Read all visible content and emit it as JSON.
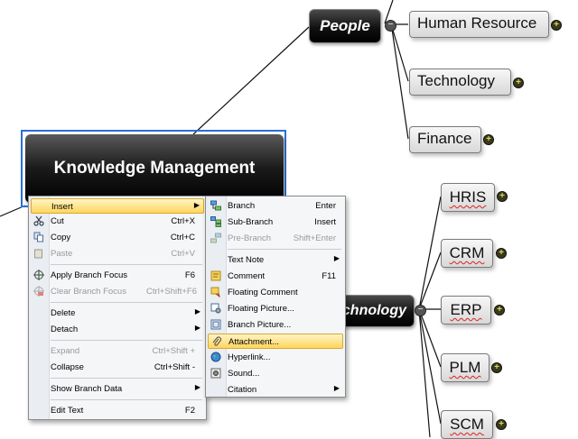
{
  "mindmap": {
    "central": "Knowledge Management",
    "people": "People",
    "technology": "chnology",
    "people_children": [
      "Human Resource",
      "Technology",
      "Finance"
    ],
    "tech_children": [
      "HRIS",
      "CRM",
      "ERP",
      "PLM",
      "SCM"
    ],
    "collapse_symbol": "−",
    "expand_symbol": "+"
  },
  "context_menu": {
    "items": [
      {
        "label": "Insert",
        "shortcut": "",
        "submenu": true,
        "highlighted": true,
        "icon": ""
      },
      {
        "label": "Cut",
        "shortcut": "Ctrl+X",
        "icon": "scissors-icon"
      },
      {
        "label": "Copy",
        "shortcut": "Ctrl+C",
        "icon": "copy-icon"
      },
      {
        "label": "Paste",
        "shortcut": "Ctrl+V",
        "disabled": true,
        "icon": "paste-icon"
      },
      {
        "label": "Apply Branch Focus",
        "shortcut": "F6",
        "icon": "focus-icon"
      },
      {
        "label": "Clear Branch Focus",
        "shortcut": "Ctrl+Shift+F6",
        "disabled": true,
        "icon": "clear-focus-icon"
      },
      {
        "label": "Delete",
        "shortcut": "",
        "submenu": true
      },
      {
        "label": "Detach",
        "shortcut": "",
        "submenu": true
      },
      {
        "label": "Expand",
        "shortcut": "Ctrl+Shift +",
        "disabled": true
      },
      {
        "label": "Collapse",
        "shortcut": "Ctrl+Shift -"
      },
      {
        "label": "Show Branch Data",
        "shortcut": "",
        "submenu": true
      },
      {
        "label": "Edit Text",
        "shortcut": "F2"
      }
    ]
  },
  "insert_submenu": {
    "items": [
      {
        "label": "Branch",
        "shortcut": "Enter",
        "icon": "branch-icon"
      },
      {
        "label": "Sub-Branch",
        "shortcut": "Insert",
        "icon": "sub-branch-icon"
      },
      {
        "label": "Pre-Branch",
        "shortcut": "Shift+Enter",
        "disabled": true,
        "icon": "pre-branch-icon"
      },
      {
        "label": "Text Note",
        "shortcut": "",
        "submenu": true
      },
      {
        "label": "Comment",
        "shortcut": "F11",
        "icon": "comment-icon"
      },
      {
        "label": "Floating Comment",
        "shortcut": "",
        "icon": "floating-comment-icon"
      },
      {
        "label": "Floating Picture...",
        "shortcut": "",
        "icon": "floating-picture-icon"
      },
      {
        "label": "Branch Picture...",
        "shortcut": "",
        "icon": "branch-picture-icon"
      },
      {
        "label": "Attachment...",
        "shortcut": "",
        "highlighted": true,
        "icon": "paperclip-icon"
      },
      {
        "label": "Hyperlink...",
        "shortcut": "",
        "icon": "globe-icon"
      },
      {
        "label": "Sound...",
        "shortcut": "",
        "icon": "speaker-icon"
      },
      {
        "label": "Citation",
        "shortcut": "",
        "submenu": true
      }
    ]
  },
  "colors": {
    "selection_border": "#2a6fd6",
    "menu_highlight": "#ffd65c",
    "node_dark": "#111111"
  }
}
